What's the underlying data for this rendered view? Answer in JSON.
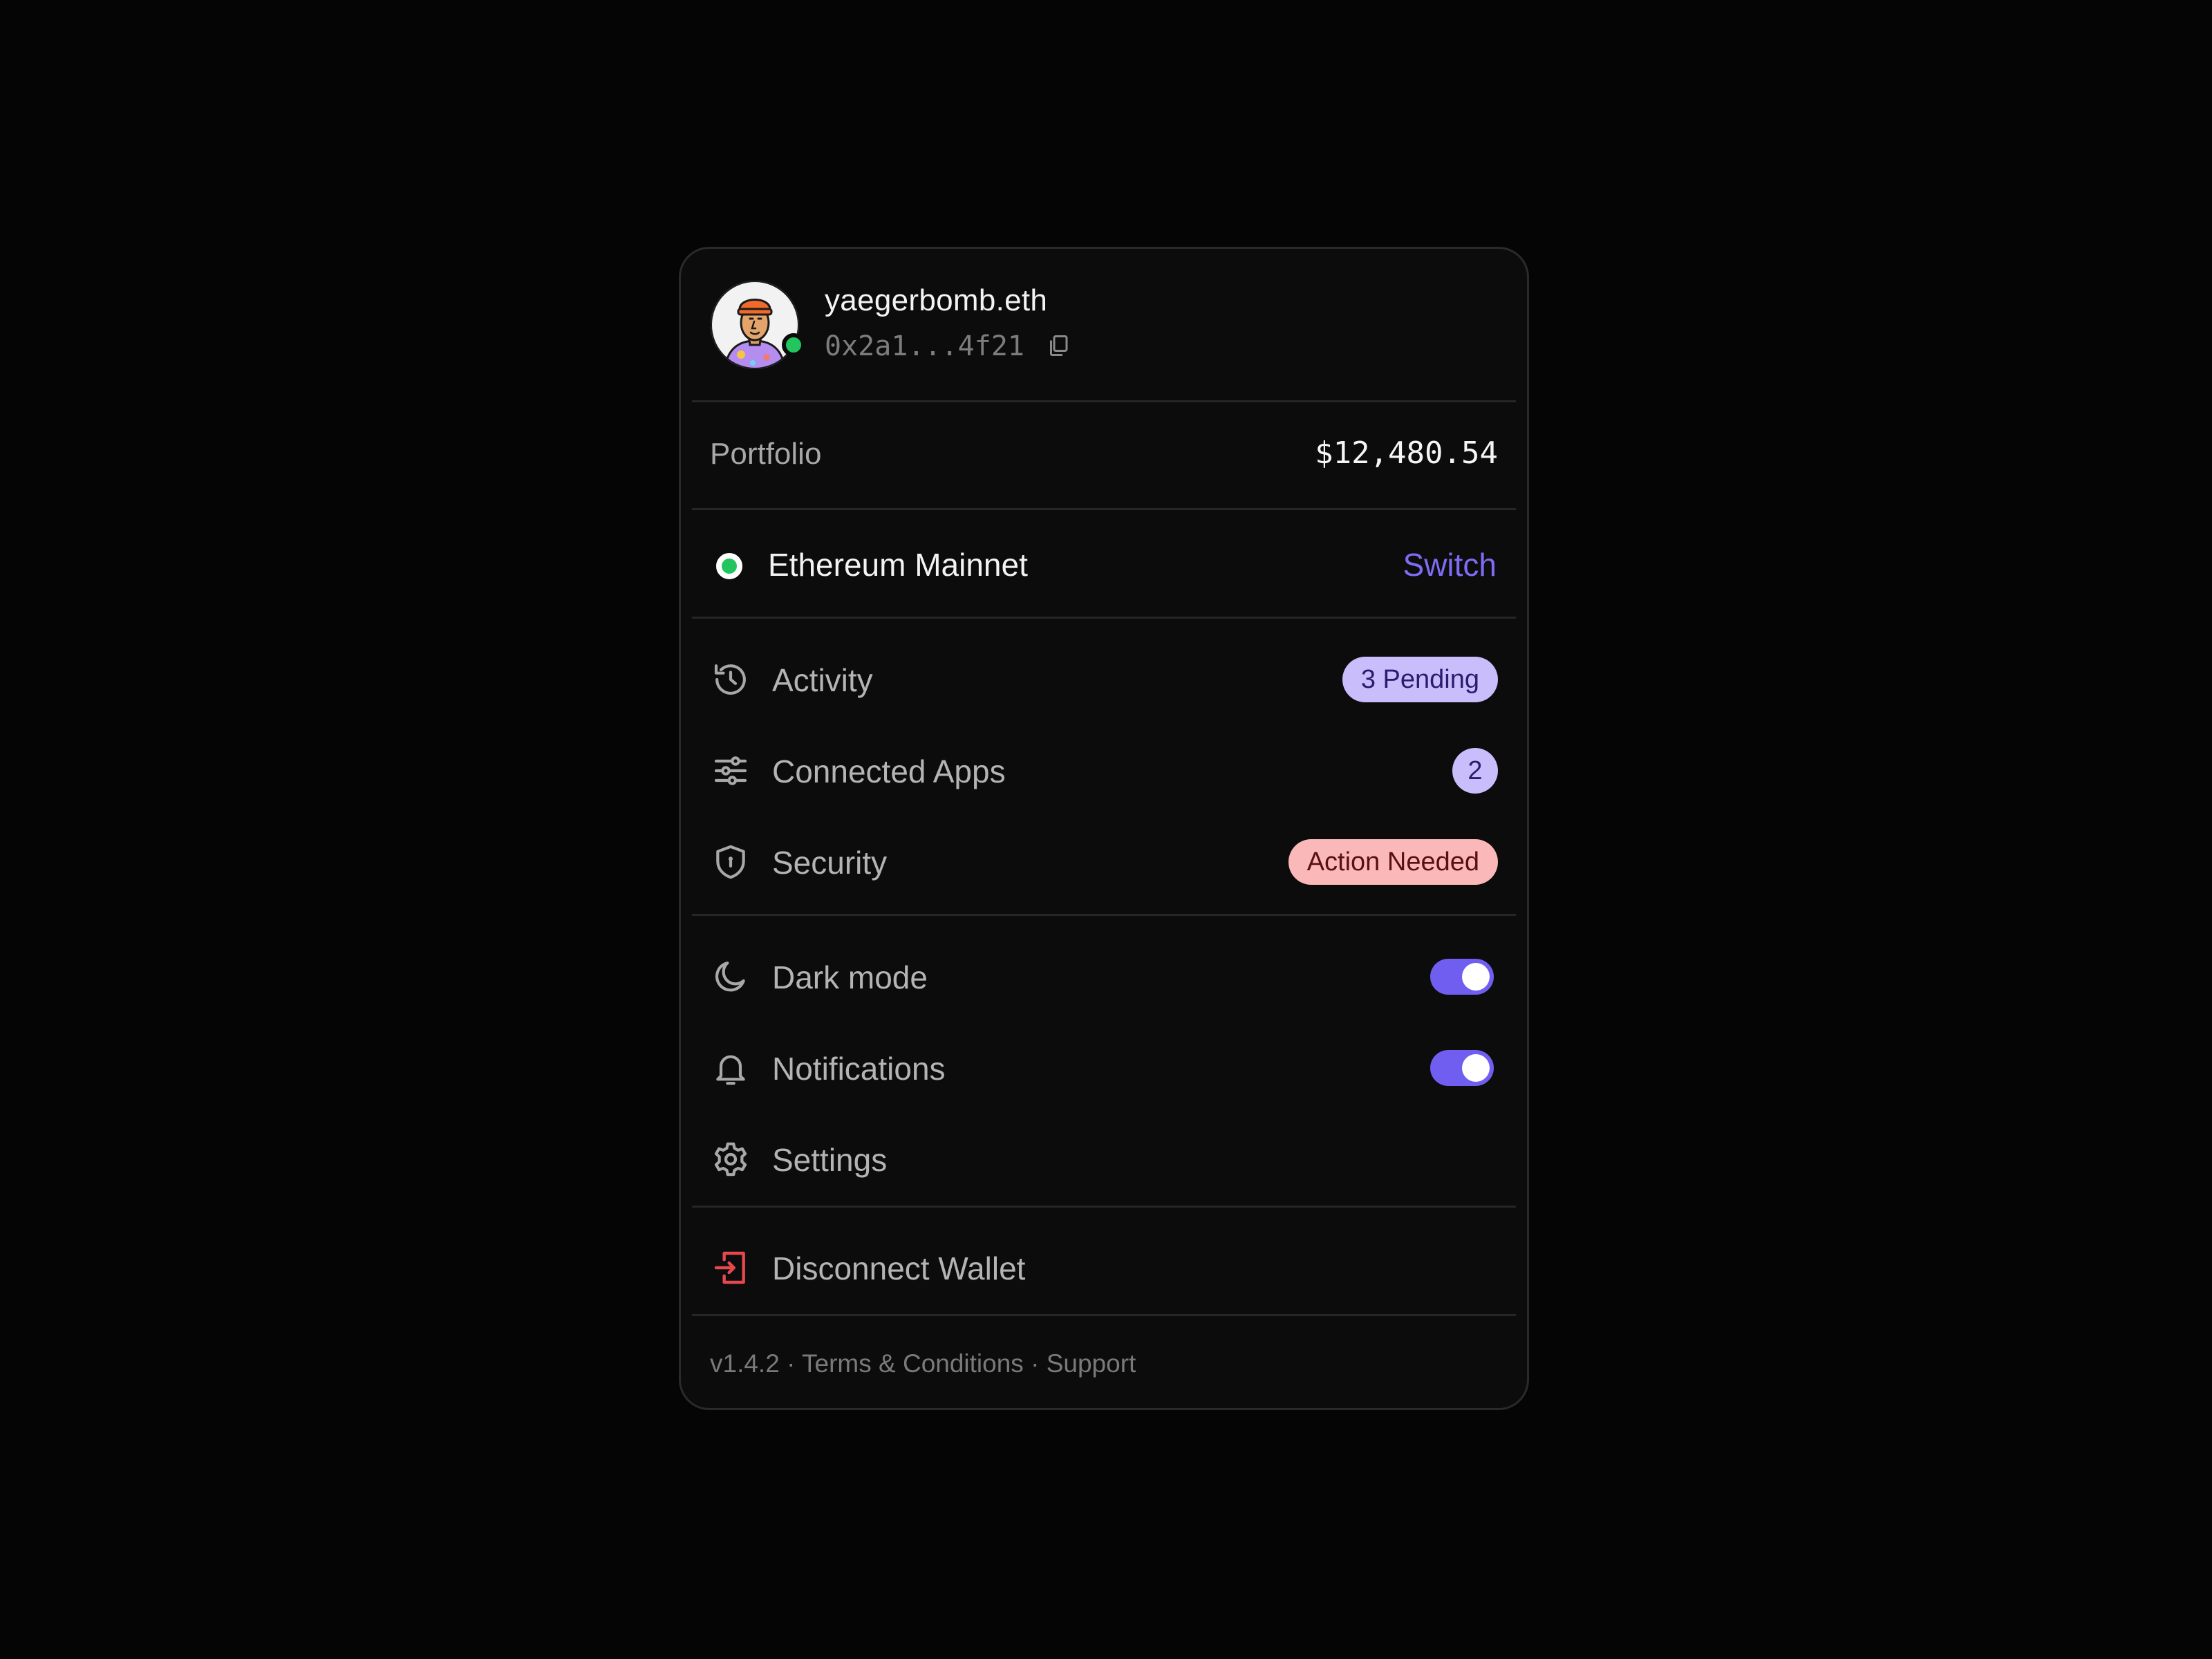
{
  "user": {
    "name": "yaegerbomb.eth",
    "address": "0x2a1...4f21",
    "status_color": "#22c55e"
  },
  "portfolio": {
    "label": "Portfolio",
    "value": "$12,480.54"
  },
  "network": {
    "name": "Ethereum Mainnet",
    "switch_label": "Switch",
    "status_color": "#22c55e"
  },
  "menu": [
    {
      "icon": "history-icon",
      "label": "Activity",
      "badge": "3 Pending"
    },
    {
      "icon": "sliders-icon",
      "label": "Connected Apps",
      "count": "2"
    },
    {
      "icon": "shield-icon",
      "label": "Security",
      "badge": "Action Needed"
    }
  ],
  "preferences": [
    {
      "icon": "moon-icon",
      "label": "Dark mode",
      "enabled": true
    },
    {
      "icon": "bell-icon",
      "label": "Notifications",
      "enabled": true
    },
    {
      "icon": "gear-icon",
      "label": "Settings"
    }
  ],
  "disconnect": {
    "icon": "log-out-icon",
    "label": "Disconnect Wallet"
  },
  "footer": {
    "version": "v1.4.2",
    "separator": " · ",
    "terms": "Terms & Conditions",
    "support": "Support"
  },
  "colors": {
    "accent": "#7e6cf2",
    "toggle_on": "#6f5ef0",
    "success": "#22c55e",
    "danger": "#e5484d",
    "badge_purple_bg": "#c9bdfb",
    "badge_red_bg": "#fbb8b8"
  }
}
